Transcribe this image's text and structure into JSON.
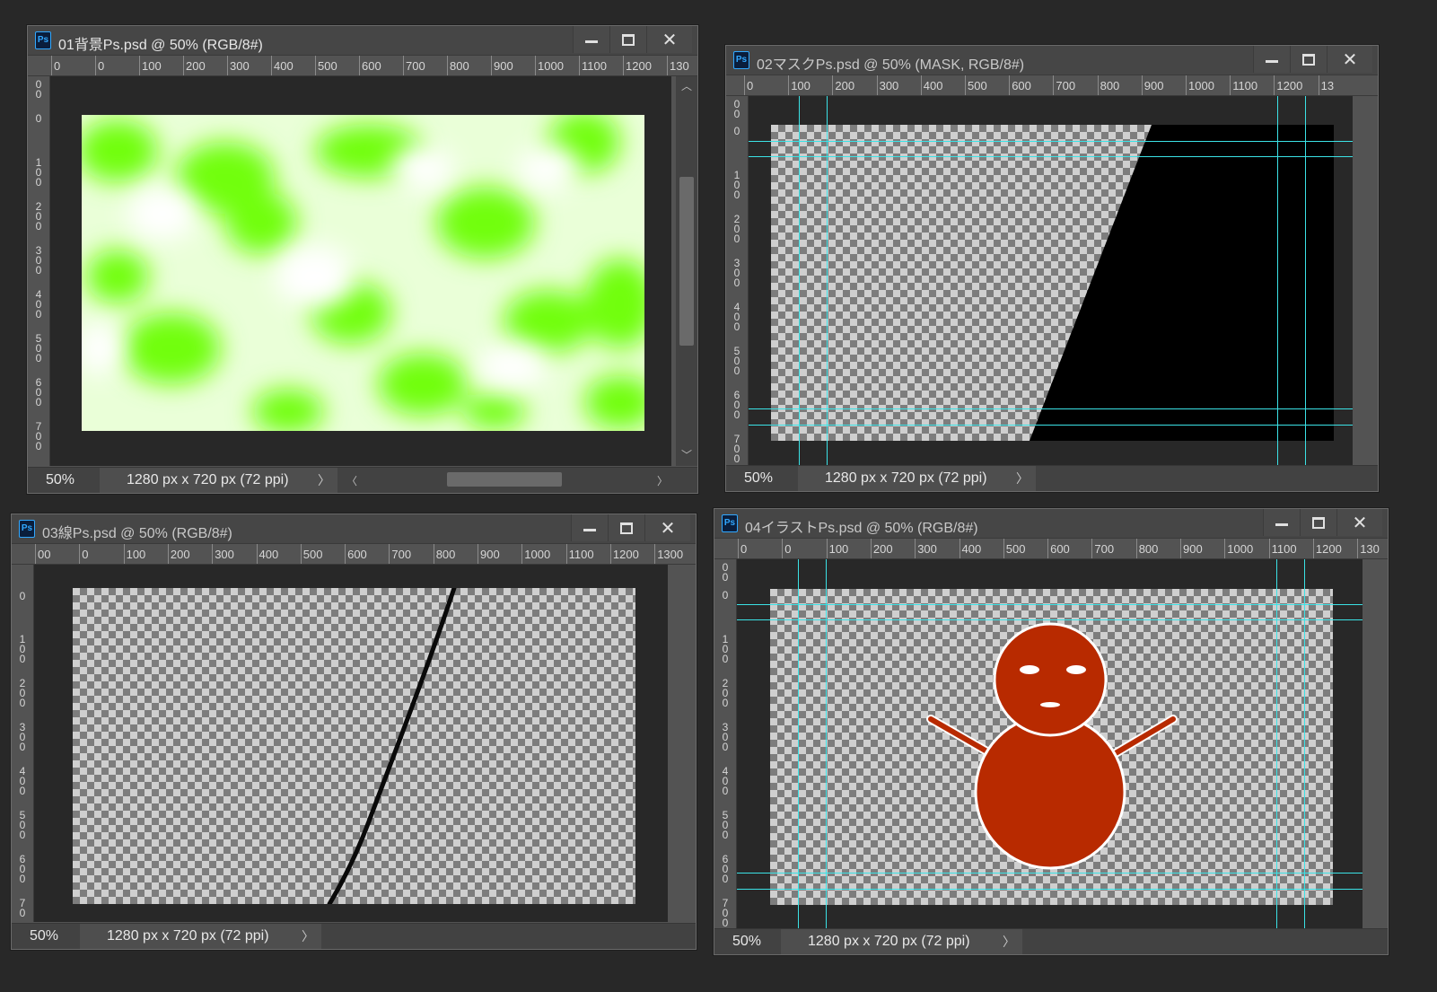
{
  "windows": [
    {
      "id": "w1",
      "title": "01背景Ps.psd @ 50% (RGB/8#)",
      "zoom": "50%",
      "doc_info": "1280 px x 720 px (72 ppi)",
      "h_ruler": [
        "0",
        "0",
        "100",
        "200",
        "300",
        "400",
        "500",
        "600",
        "700",
        "800",
        "900",
        "1000",
        "1100",
        "1200",
        "130"
      ],
      "v_ruler": [
        "0\n0",
        "0",
        "1\n0\n0",
        "2\n0\n0",
        "3\n0\n0",
        "4\n0\n0",
        "5\n0\n0",
        "6\n0\n0",
        "7\n0\n0"
      ],
      "content": "clouds",
      "cloud_colors": [
        "#71ff0a",
        "#ffffff"
      ]
    },
    {
      "id": "w2",
      "title": "02マスクPs.psd @ 50% (MASK, RGB/8#)",
      "zoom": "50%",
      "doc_info": "1280 px x 720 px (72 ppi)",
      "h_ruler": [
        "0",
        "100",
        "200",
        "300",
        "400",
        "500",
        "600",
        "700",
        "800",
        "900",
        "1000",
        "1100",
        "1200",
        "13"
      ],
      "v_ruler": [
        "0\n0",
        "0",
        "1\n0\n0",
        "2\n0\n0",
        "3\n0\n0",
        "4\n0\n0",
        "5\n0\n0",
        "6\n0\n0",
        "7\n0\n0"
      ],
      "content": "mask"
    },
    {
      "id": "w3",
      "title": "03線Ps.psd @ 50% (RGB/8#)",
      "zoom": "50%",
      "doc_info": "1280 px x 720 px (72 ppi)",
      "h_ruler": [
        "00",
        "0",
        "100",
        "200",
        "300",
        "400",
        "500",
        "600",
        "700",
        "800",
        "900",
        "1000",
        "1100",
        "1200",
        "1300"
      ],
      "v_ruler": [
        "0",
        "1\n0\n0",
        "2\n0\n0",
        "3\n0\n0",
        "4\n0\n0",
        "5\n0\n0",
        "6\n0\n0",
        "7\n0"
      ],
      "content": "line"
    },
    {
      "id": "w4",
      "title": "04イラストPs.psd @ 50% (RGB/8#)",
      "zoom": "50%",
      "doc_info": "1280 px x 720 px (72 ppi)",
      "h_ruler": [
        "0",
        "0",
        "100",
        "200",
        "300",
        "400",
        "500",
        "600",
        "700",
        "800",
        "900",
        "1000",
        "1100",
        "1200",
        "130"
      ],
      "v_ruler": [
        "0\n0",
        "0",
        "1\n0\n0",
        "2\n0\n0",
        "3\n0\n0",
        "4\n0\n0",
        "5\n0\n0",
        "6\n0\n0",
        "7\n0\n0"
      ],
      "content": "snowman",
      "snowman_color": "#b82a00"
    }
  ],
  "colors": {
    "guide": "#3be2e6",
    "workspace_bg": "#282828",
    "panel_bg": "#535353"
  }
}
